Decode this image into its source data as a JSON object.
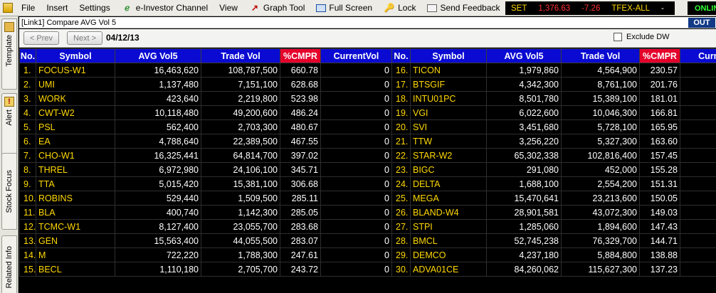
{
  "menu": {
    "items": [
      {
        "name": "menu-file",
        "label": "File",
        "icon": ""
      },
      {
        "name": "menu-insert",
        "label": "Insert",
        "icon": ""
      },
      {
        "name": "menu-settings",
        "label": "Settings",
        "icon": ""
      },
      {
        "name": "menu-e-investor-channel",
        "label": "e-Investor Channel",
        "icon": "e-investor-icon"
      },
      {
        "name": "menu-view",
        "label": "View",
        "icon": ""
      },
      {
        "name": "menu-graph-tool",
        "label": "Graph Tool",
        "icon": "graph-icon"
      },
      {
        "name": "menu-full-screen",
        "label": "Full Screen",
        "icon": "full-screen-icon"
      },
      {
        "name": "menu-lock",
        "label": "Lock",
        "icon": "lock-icon"
      },
      {
        "name": "menu-send-feedback",
        "label": "Send Feedback",
        "icon": "feedback-icon"
      }
    ]
  },
  "ticker": {
    "index_name": "SET",
    "index_value": "1,376.63",
    "index_change": "-7.26",
    "tfex_label": "TFEX-ALL",
    "tfex_value": "-"
  },
  "status": {
    "online": "ONLIN"
  },
  "sidebar": {
    "tabs": [
      "Template",
      "Alert",
      "Stock Focus",
      "Related Info"
    ]
  },
  "window": {
    "title": "[Link1] Compare AVG Vol 5",
    "out_label": "OUT"
  },
  "toolbar": {
    "prev_label": "< Prev",
    "next_label": "Next >",
    "date": "04/12/13",
    "exclude_label": "Exclude DW",
    "exclude_checked": false
  },
  "table": {
    "headers": [
      "No.",
      "Symbol",
      "AVG Vol5",
      "Trade Vol",
      "%CMPR",
      "CurrentVol",
      "No.",
      "Symbol",
      "AVG Vol5",
      "Trade Vol",
      "%CMPR",
      "CurrentVol"
    ],
    "left": [
      {
        "no": "1.",
        "symbol": "FOCUS-W1",
        "avg": "16,463,620",
        "trade": "108,787,500",
        "cmpr": "660.78",
        "current": "0"
      },
      {
        "no": "2.",
        "symbol": "UMI",
        "avg": "1,137,480",
        "trade": "7,151,100",
        "cmpr": "628.68",
        "current": "0"
      },
      {
        "no": "3.",
        "symbol": "WORK",
        "avg": "423,640",
        "trade": "2,219,800",
        "cmpr": "523.98",
        "current": "0"
      },
      {
        "no": "4.",
        "symbol": "CWT-W2",
        "avg": "10,118,480",
        "trade": "49,200,600",
        "cmpr": "486.24",
        "current": "0"
      },
      {
        "no": "5.",
        "symbol": "PSL",
        "avg": "562,400",
        "trade": "2,703,300",
        "cmpr": "480.67",
        "current": "0"
      },
      {
        "no": "6.",
        "symbol": "EA",
        "avg": "4,788,640",
        "trade": "22,389,500",
        "cmpr": "467.55",
        "current": "0"
      },
      {
        "no": "7.",
        "symbol": "CHO-W1",
        "avg": "16,325,441",
        "trade": "64,814,700",
        "cmpr": "397.02",
        "current": "0"
      },
      {
        "no": "8.",
        "symbol": "THREL",
        "avg": "6,972,980",
        "trade": "24,106,100",
        "cmpr": "345.71",
        "current": "0"
      },
      {
        "no": "9.",
        "symbol": "TTA",
        "avg": "5,015,420",
        "trade": "15,381,100",
        "cmpr": "306.68",
        "current": "0"
      },
      {
        "no": "10.",
        "symbol": "ROBINS",
        "avg": "529,440",
        "trade": "1,509,500",
        "cmpr": "285.11",
        "current": "0"
      },
      {
        "no": "11.",
        "symbol": "BLA",
        "avg": "400,740",
        "trade": "1,142,300",
        "cmpr": "285.05",
        "current": "0"
      },
      {
        "no": "12.",
        "symbol": "TCMC-W1",
        "avg": "8,127,400",
        "trade": "23,055,700",
        "cmpr": "283.68",
        "current": "0"
      },
      {
        "no": "13.",
        "symbol": "GEN",
        "avg": "15,563,400",
        "trade": "44,055,500",
        "cmpr": "283.07",
        "current": "0"
      },
      {
        "no": "14.",
        "symbol": "M",
        "avg": "722,220",
        "trade": "1,788,300",
        "cmpr": "247.61",
        "current": "0"
      },
      {
        "no": "15.",
        "symbol": "BECL",
        "avg": "1,110,180",
        "trade": "2,705,700",
        "cmpr": "243.72",
        "current": "0"
      }
    ],
    "right": [
      {
        "no": "16.",
        "symbol": "TICON",
        "avg": "1,979,860",
        "trade": "4,564,900",
        "cmpr": "230.57",
        "current": ""
      },
      {
        "no": "17.",
        "symbol": "BTSGIF",
        "avg": "4,342,300",
        "trade": "8,761,100",
        "cmpr": "201.76",
        "current": ""
      },
      {
        "no": "18.",
        "symbol": "INTU01PC",
        "avg": "8,501,780",
        "trade": "15,389,100",
        "cmpr": "181.01",
        "current": ""
      },
      {
        "no": "19.",
        "symbol": "VGI",
        "avg": "6,022,600",
        "trade": "10,046,300",
        "cmpr": "166.81",
        "current": ""
      },
      {
        "no": "20.",
        "symbol": "SVI",
        "avg": "3,451,680",
        "trade": "5,728,100",
        "cmpr": "165.95",
        "current": ""
      },
      {
        "no": "21.",
        "symbol": "TTW",
        "avg": "3,256,220",
        "trade": "5,327,300",
        "cmpr": "163.60",
        "current": ""
      },
      {
        "no": "22.",
        "symbol": "STAR-W2",
        "avg": "65,302,338",
        "trade": "102,816,400",
        "cmpr": "157.45",
        "current": ""
      },
      {
        "no": "23.",
        "symbol": "BIGC",
        "avg": "291,080",
        "trade": "452,000",
        "cmpr": "155.28",
        "current": ""
      },
      {
        "no": "24.",
        "symbol": "DELTA",
        "avg": "1,688,100",
        "trade": "2,554,200",
        "cmpr": "151.31",
        "current": ""
      },
      {
        "no": "25.",
        "symbol": "MEGA",
        "avg": "15,470,641",
        "trade": "23,213,600",
        "cmpr": "150.05",
        "current": ""
      },
      {
        "no": "26.",
        "symbol": "BLAND-W4",
        "avg": "28,901,581",
        "trade": "43,072,300",
        "cmpr": "149.03",
        "current": ""
      },
      {
        "no": "27.",
        "symbol": "STPI",
        "avg": "1,285,060",
        "trade": "1,894,600",
        "cmpr": "147.43",
        "current": ""
      },
      {
        "no": "28.",
        "symbol": "BMCL",
        "avg": "52,745,238",
        "trade": "76,329,700",
        "cmpr": "144.71",
        "current": ""
      },
      {
        "no": "29.",
        "symbol": "DEMCO",
        "avg": "4,237,180",
        "trade": "5,884,800",
        "cmpr": "138.88",
        "current": ""
      },
      {
        "no": "30.",
        "symbol": "ADVA01CE",
        "avg": "84,260,062",
        "trade": "115,627,300",
        "cmpr": "137.23",
        "current": ""
      }
    ]
  },
  "colors": {
    "header_bg": "#0a0ad2",
    "cmpr_header_bg": "#e4002b",
    "symbol_text": "#ffd800",
    "value_text": "#ffffff",
    "ticker_down": "#ff3030",
    "online": "#33ff33"
  }
}
